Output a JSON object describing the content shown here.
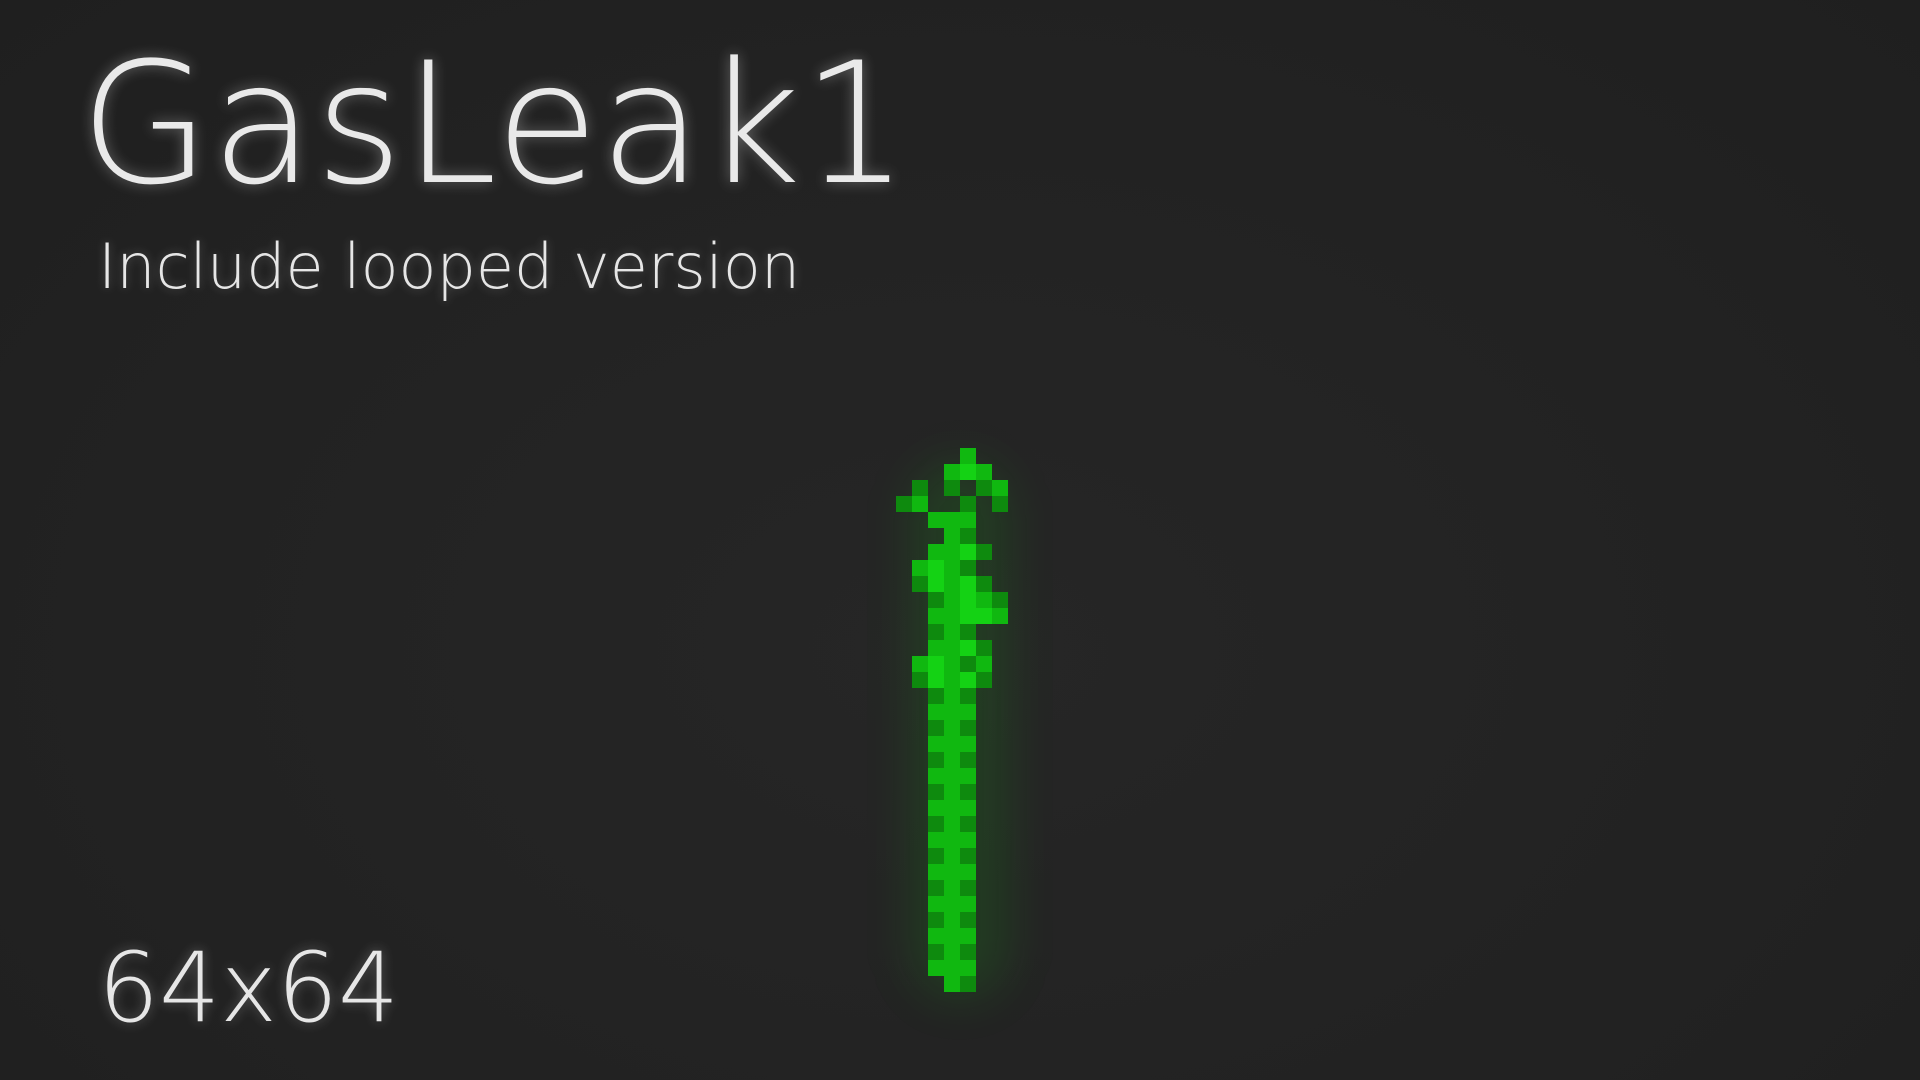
{
  "title": "GasLeak1",
  "subtitle": "Include looped version",
  "size_label": "64x64",
  "colors": {
    "background": "#232323",
    "text": "#e9e9e9",
    "gas_bright": "#14d214",
    "gas_mid": "#10b810",
    "gas_dark": "#0e8a0e"
  },
  "sprite": {
    "icon": "green-gas-plume-icon"
  }
}
